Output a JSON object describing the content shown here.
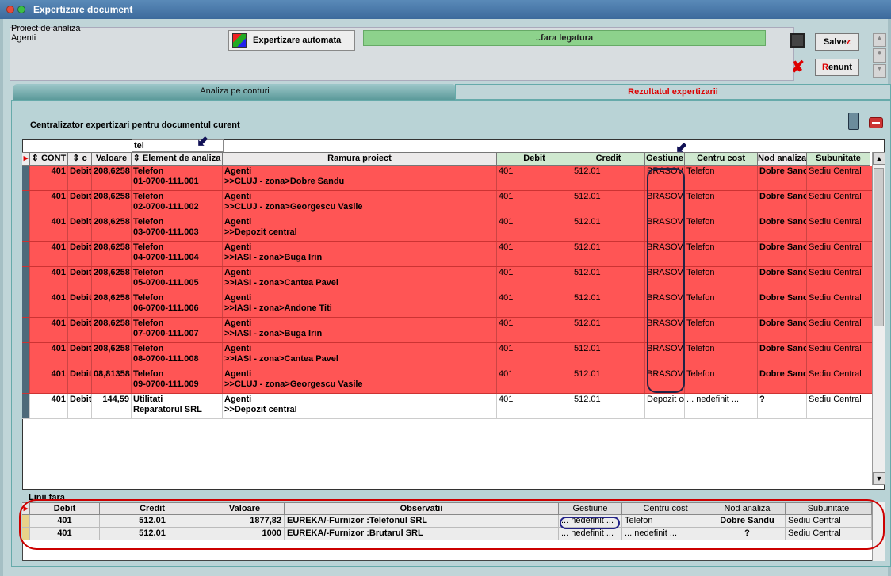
{
  "window": {
    "title": "Expertizare document"
  },
  "top": {
    "project_label": "Proiect de analiza",
    "project_value": "Agenti",
    "auto_button": "Expertizare automata",
    "status_bar": "..fara legatura",
    "save_pre": "Salve",
    "save_key": "z",
    "cancel_key": "R",
    "cancel_post": "enunt"
  },
  "tabs": [
    {
      "label": "Analiza pe conturi"
    },
    {
      "label": "Rezultatul expertizarii"
    }
  ],
  "caption": "Centralizator expertizari pentru documentul curent",
  "filter_value": "tel",
  "columns": [
    "CONT",
    "c",
    "Valoare",
    "Element de analiza",
    "Ramura proiect",
    "Debit",
    "Credit",
    "Gestiune",
    "Centru cost",
    "Nod analiza",
    "Subunitate"
  ],
  "rows": [
    {
      "cont": "401",
      "d": "Debit",
      "val": "208,6258",
      "el1": "Telefon",
      "el2": "01-0700-111.001",
      "r1": "Agenti",
      "r2": ">>CLUJ - zona>Dobre Sandu",
      "debit": "401",
      "credit": "512.01",
      "gest": "BRASOV -",
      "cc": "Telefon",
      "nod": "Dobre Sanc",
      "sub": "Sediu Central"
    },
    {
      "cont": "401",
      "d": "Debit",
      "val": "208,6258",
      "el1": "Telefon",
      "el2": "02-0700-111.002",
      "r1": "Agenti",
      "r2": ">>CLUJ - zona>Georgescu Vasile",
      "debit": "401",
      "credit": "512.01",
      "gest": "BRASOV -",
      "cc": "Telefon",
      "nod": "Dobre Sanc",
      "sub": "Sediu Central"
    },
    {
      "cont": "401",
      "d": "Debit",
      "val": "208,6258",
      "el1": "Telefon",
      "el2": "03-0700-111.003",
      "r1": "Agenti",
      "r2": ">>Depozit central",
      "debit": "401",
      "credit": "512.01",
      "gest": "BRASOV -",
      "cc": "Telefon",
      "nod": "Dobre Sanc",
      "sub": "Sediu Central"
    },
    {
      "cont": "401",
      "d": "Debit",
      "val": "208,6258",
      "el1": "Telefon",
      "el2": "04-0700-111.004",
      "r1": "Agenti",
      "r2": ">>IASI - zona>Buga Irin",
      "debit": "401",
      "credit": "512.01",
      "gest": "BRASOV -",
      "cc": "Telefon",
      "nod": "Dobre Sanc",
      "sub": "Sediu Central"
    },
    {
      "cont": "401",
      "d": "Debit",
      "val": "208,6258",
      "el1": "Telefon",
      "el2": "05-0700-111.005",
      "r1": "Agenti",
      "r2": ">>IASI - zona>Cantea Pavel",
      "debit": "401",
      "credit": "512.01",
      "gest": "BRASOV -",
      "cc": "Telefon",
      "nod": "Dobre Sanc",
      "sub": "Sediu Central"
    },
    {
      "cont": "401",
      "d": "Debit",
      "val": "208,6258",
      "el1": "Telefon",
      "el2": "06-0700-111.006",
      "r1": "Agenti",
      "r2": ">>IASI - zona>Andone Titi",
      "debit": "401",
      "credit": "512.01",
      "gest": "BRASOV -",
      "cc": "Telefon",
      "nod": "Dobre Sanc",
      "sub": "Sediu Central"
    },
    {
      "cont": "401",
      "d": "Debit",
      "val": "208,6258",
      "el1": "Telefon",
      "el2": "07-0700-111.007",
      "r1": "Agenti",
      "r2": ">>IASI - zona>Buga Irin",
      "debit": "401",
      "credit": "512.01",
      "gest": "BRASOV -",
      "cc": "Telefon",
      "nod": "Dobre Sanc",
      "sub": "Sediu Central"
    },
    {
      "cont": "401",
      "d": "Debit",
      "val": "208,6258",
      "el1": "Telefon",
      "el2": "08-0700-111.008",
      "r1": "Agenti",
      "r2": ">>IASI - zona>Cantea Pavel",
      "debit": "401",
      "credit": "512.01",
      "gest": "BRASOV -",
      "cc": "Telefon",
      "nod": "Dobre Sanc",
      "sub": "Sediu Central"
    },
    {
      "cont": "401",
      "d": "Debit",
      "val": "08,81358",
      "el1": "Telefon",
      "el2": "09-0700-111.009",
      "r1": "Agenti",
      "r2": ">>CLUJ - zona>Georgescu Vasile",
      "debit": "401",
      "credit": "512.01",
      "gest": "BRASOV -",
      "cc": "Telefon",
      "nod": "Dobre Sanc",
      "sub": "Sediu Central"
    },
    {
      "cont": "401",
      "d": "Debit",
      "val": "144,59",
      "el1": "Utilitati",
      "el2": "Reparatorul SRL",
      "r1": "Agenti",
      "r2": ">>Depozit central",
      "debit": "401",
      "credit": "512.01",
      "gest": "Depozit cei",
      "cc": "... nedefinit ...",
      "nod": "?",
      "sub": "Sediu Central",
      "white": true
    }
  ],
  "lower": {
    "caption": "Linii fara",
    "columns": [
      "Debit",
      "Credit",
      "Valoare",
      "Observatii",
      "Gestiune",
      "Centru cost",
      "Nod analiza",
      "Subunitate"
    ],
    "rows": [
      {
        "debit": "401",
        "credit": "512.01",
        "val": "1877,82",
        "obs": "EUREKA/-Furnizor :Telefonul SRL",
        "gest": "... nedefinit ...",
        "cc": "Telefon",
        "nod": "Dobre Sandu",
        "sub": "Sediu Central"
      },
      {
        "debit": "401",
        "credit": "512.01",
        "val": "1000",
        "obs": "EUREKA/-Furnizor :Brutarul SRL",
        "gest": "... nedefinit ...",
        "cc": "... nedefinit ...",
        "nod": "?",
        "sub": "Sediu Central"
      }
    ]
  }
}
